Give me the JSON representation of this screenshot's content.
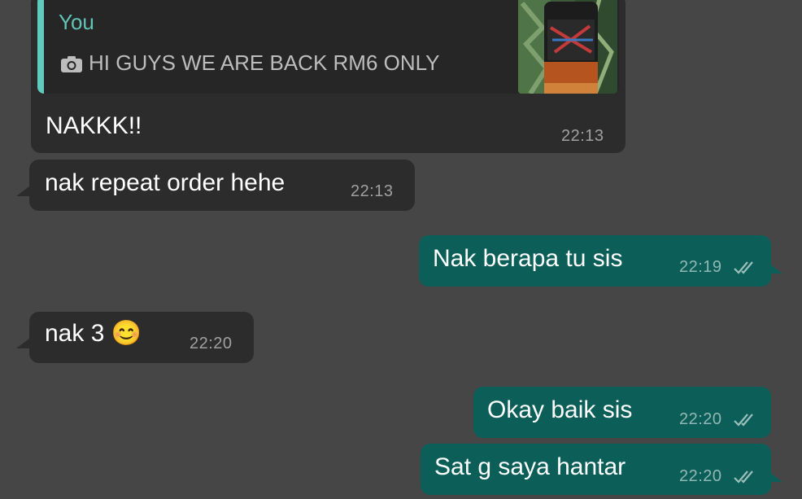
{
  "quoted_reply": {
    "author": "You",
    "caption": "HI GUYS WE ARE BACK RM6 ONLY",
    "icon": "camera-icon"
  },
  "messages": [
    {
      "direction": "incoming",
      "text": "NAKKK!!",
      "time": "22:13"
    },
    {
      "direction": "incoming",
      "text": "nak repeat order hehe",
      "time": "22:13"
    },
    {
      "direction": "outgoing",
      "text": "Nak berapa tu sis",
      "time": "22:19",
      "status": "read"
    },
    {
      "direction": "incoming",
      "text": "nak 3 😊",
      "time": "22:20"
    },
    {
      "direction": "outgoing",
      "text": "Okay baik sis",
      "time": "22:20",
      "status": "read"
    },
    {
      "direction": "outgoing",
      "text": "Sat g saya hantar",
      "time": "22:20",
      "status": "read"
    }
  ],
  "colors": {
    "background": "#474646",
    "incoming_bubble": "#2c2c2c",
    "outgoing_bubble": "#0b5f58",
    "quote_accent": "#5fcbbe"
  }
}
